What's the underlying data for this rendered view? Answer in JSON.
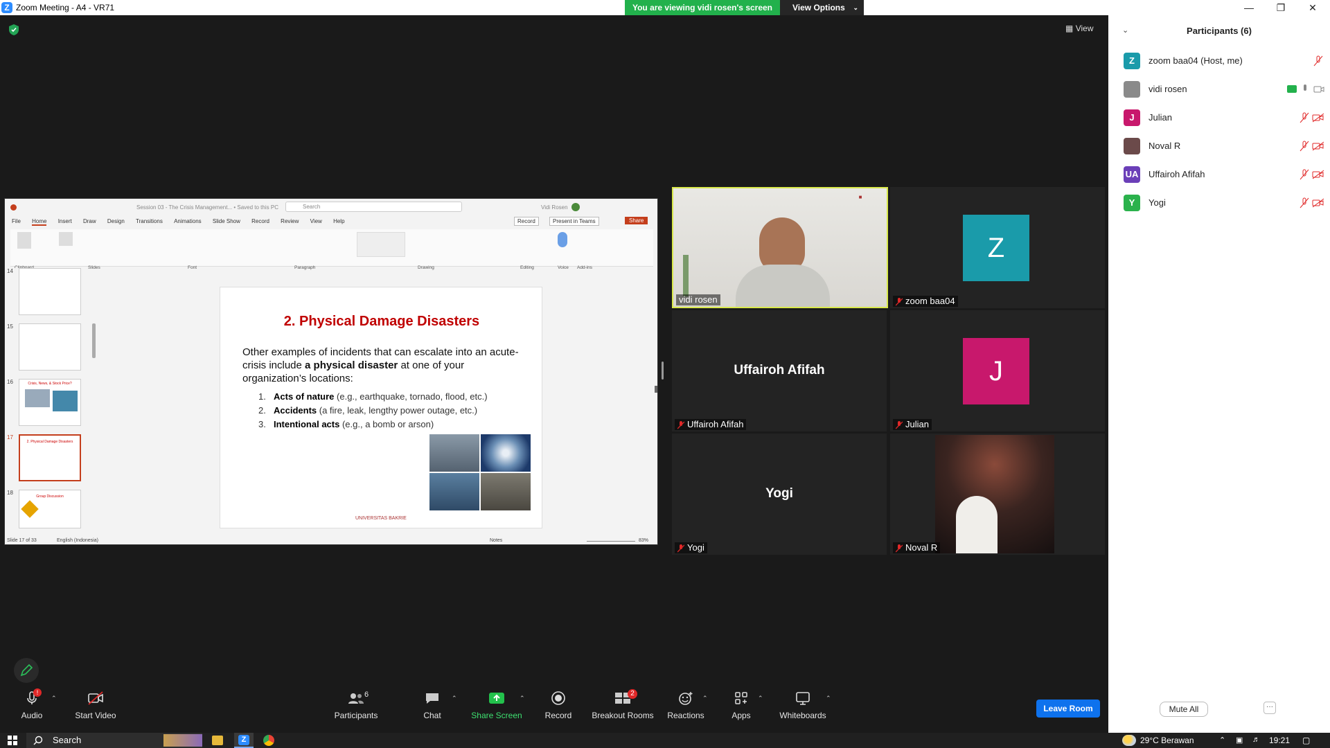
{
  "window": {
    "title": "Zoom Meeting - A4 - VR71",
    "banner": "You are viewing vidi rosen's screen",
    "view_options": "View Options",
    "view_label": "View"
  },
  "shared_screen": {
    "app_search": "Search",
    "file_title": "Session 03 - The Crisis Management... • Saved to this PC",
    "user": "Vidi Rosen",
    "menu_tabs": [
      "File",
      "Home",
      "Insert",
      "Draw",
      "Design",
      "Transitions",
      "Animations",
      "Slide Show",
      "Record",
      "Review",
      "View",
      "Help"
    ],
    "record_btn": "Record",
    "present_btn": "Present in Teams",
    "share_btn": "Share",
    "ribbon_groups": [
      "Clipboard",
      "Slides",
      "Font",
      "Paragraph",
      "Drawing",
      "Editing",
      "Voice",
      "Add-ins"
    ],
    "thumb_numbers": [
      "14",
      "15",
      "16",
      "17",
      "18"
    ],
    "thumb_16_title": "Crisis, News, & Stock Price?",
    "thumb_17_title": "2. Physical Damage Disasters",
    "thumb_18_title": "Group Discussion",
    "slide": {
      "title": "2. Physical Damage Disasters",
      "body_pre": "Other examples of incidents that can escalate into an acute-crisis include ",
      "body_bold": "a physical disaster",
      "body_post": " at one of your organization’s locations:",
      "items": [
        {
          "num": "1.",
          "bold": "Acts of nature",
          "rest": " (e.g., earthquake, tornado, flood, etc.)"
        },
        {
          "num": "2.",
          "bold": "Accidents",
          "rest": " (a fire, leak, lengthy power outage, etc.)"
        },
        {
          "num": "3.",
          "bold": "Intentional acts",
          "rest": " (e.g., a bomb or arson)"
        }
      ],
      "logo": "UNIVERSITAS BAKRIE"
    },
    "status_left": "Slide 17 of 33",
    "status_lang": "English (Indonesia)",
    "status_notes": "Notes",
    "zoom": "83%"
  },
  "tiles": [
    {
      "name": "vidi rosen",
      "type": "video"
    },
    {
      "name": "zoom baa04",
      "initial": "Z",
      "color": "#1a9baa"
    },
    {
      "name": "Uffairoh Afifah",
      "center": "Uffairoh Afifah"
    },
    {
      "name": "Julian",
      "initial": "J",
      "color": "#c8186c"
    },
    {
      "name": "Yogi",
      "center": "Yogi"
    },
    {
      "name": "Noval R",
      "type": "photo"
    }
  ],
  "participants": {
    "title": "Participants (6)",
    "list": [
      {
        "initial": "Z",
        "name": "zoom baa04 (Host, me)",
        "color": "#1a9baa"
      },
      {
        "initial": "",
        "name": "vidi rosen",
        "color": "#8a8a8a"
      },
      {
        "initial": "J",
        "name": "Julian",
        "color": "#c8186c"
      },
      {
        "initial": "",
        "name": "Noval R",
        "color": "#6b4a4a"
      },
      {
        "initial": "UA",
        "name": "Uffairoh Afifah",
        "color": "#6b3fb8"
      },
      {
        "initial": "Y",
        "name": "Yogi",
        "color": "#2bb24c"
      }
    ],
    "mute_all": "Mute All",
    "more": "···"
  },
  "toolbar": {
    "audio": "Audio",
    "start_video": "Start Video",
    "participants": "Participants",
    "participants_count": "6",
    "chat": "Chat",
    "share_screen": "Share Screen",
    "record": "Record",
    "breakout": "Breakout Rooms",
    "breakout_badge": "2",
    "reactions": "Reactions",
    "apps": "Apps",
    "whiteboards": "Whiteboards",
    "leave": "Leave Room",
    "audio_badge": "!"
  },
  "taskbar": {
    "search": "Search",
    "weather": "29°C  Berawan",
    "time": "19:21"
  }
}
